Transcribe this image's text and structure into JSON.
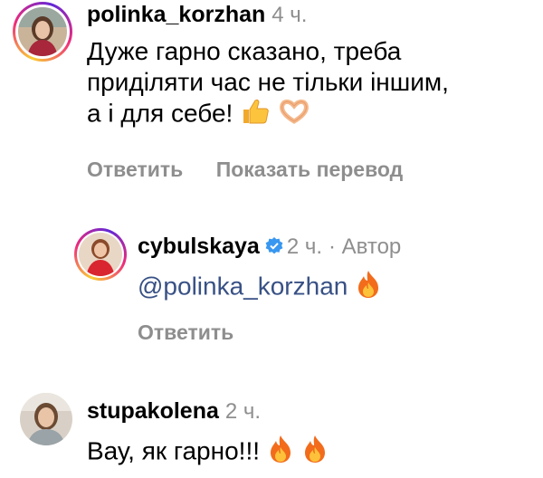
{
  "comments": [
    {
      "username": "polinka_korzhan",
      "time": "4 ч.",
      "lines": [
        "Дуже гарно сказано, треба",
        "приділяти час не тільки іншим,",
        "а і для себе!"
      ],
      "emoji": [
        "thumbs-up",
        "heart-hands"
      ],
      "actions": [
        "Ответить",
        "Показать перевод"
      ]
    },
    {
      "username": "cybulskaya",
      "verified": true,
      "time": "2 ч.",
      "author_tag": "· Автор",
      "mention": "@polinka_korzhan",
      "emoji": [
        "fire"
      ],
      "actions": [
        "Ответить"
      ]
    },
    {
      "username": "stupakolena",
      "time": "2 ч.",
      "text": "Вау, як гарно!!!",
      "emoji": [
        "fire",
        "fire"
      ]
    }
  ],
  "colors": {
    "meta": "#8e8e8e",
    "mention": "#385185",
    "verified": "#3897f0"
  }
}
